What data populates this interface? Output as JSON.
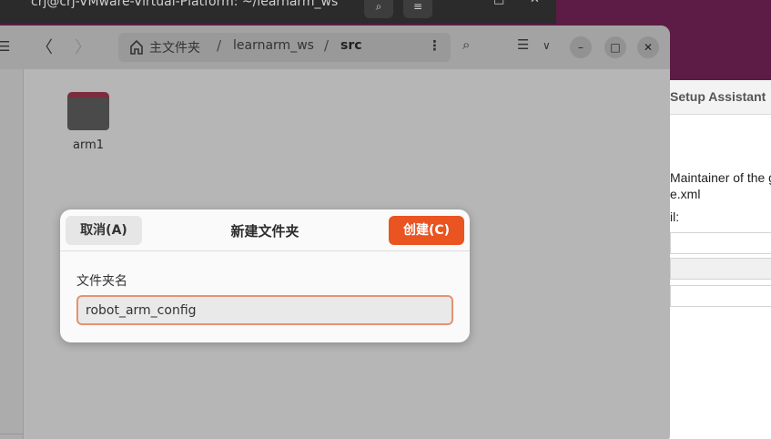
{
  "terminal": {
    "title": "crj@crj-VMware-Virtual-Platform: ~/learnarm_ws"
  },
  "assistant": {
    "title": "Setup Assistant",
    "lines": [
      "Maintainer of the g",
      "e.xml",
      "il:"
    ]
  },
  "file_manager": {
    "path": {
      "home": "主文件夹",
      "separator": "/",
      "folder": "learnarm_ws",
      "current": "src"
    },
    "items": [
      {
        "name": "arm1",
        "icon": "folder-icon"
      }
    ]
  },
  "dialog": {
    "title": "新建文件夹",
    "cancel_label": "取消(A)",
    "create_label": "创建(C)",
    "field_label": "文件夹名",
    "field_value": "robot_arm_config"
  },
  "colors": {
    "accent": "#e95420",
    "input_focus_border": "#e5936f",
    "desktop": "#5c1c45"
  }
}
